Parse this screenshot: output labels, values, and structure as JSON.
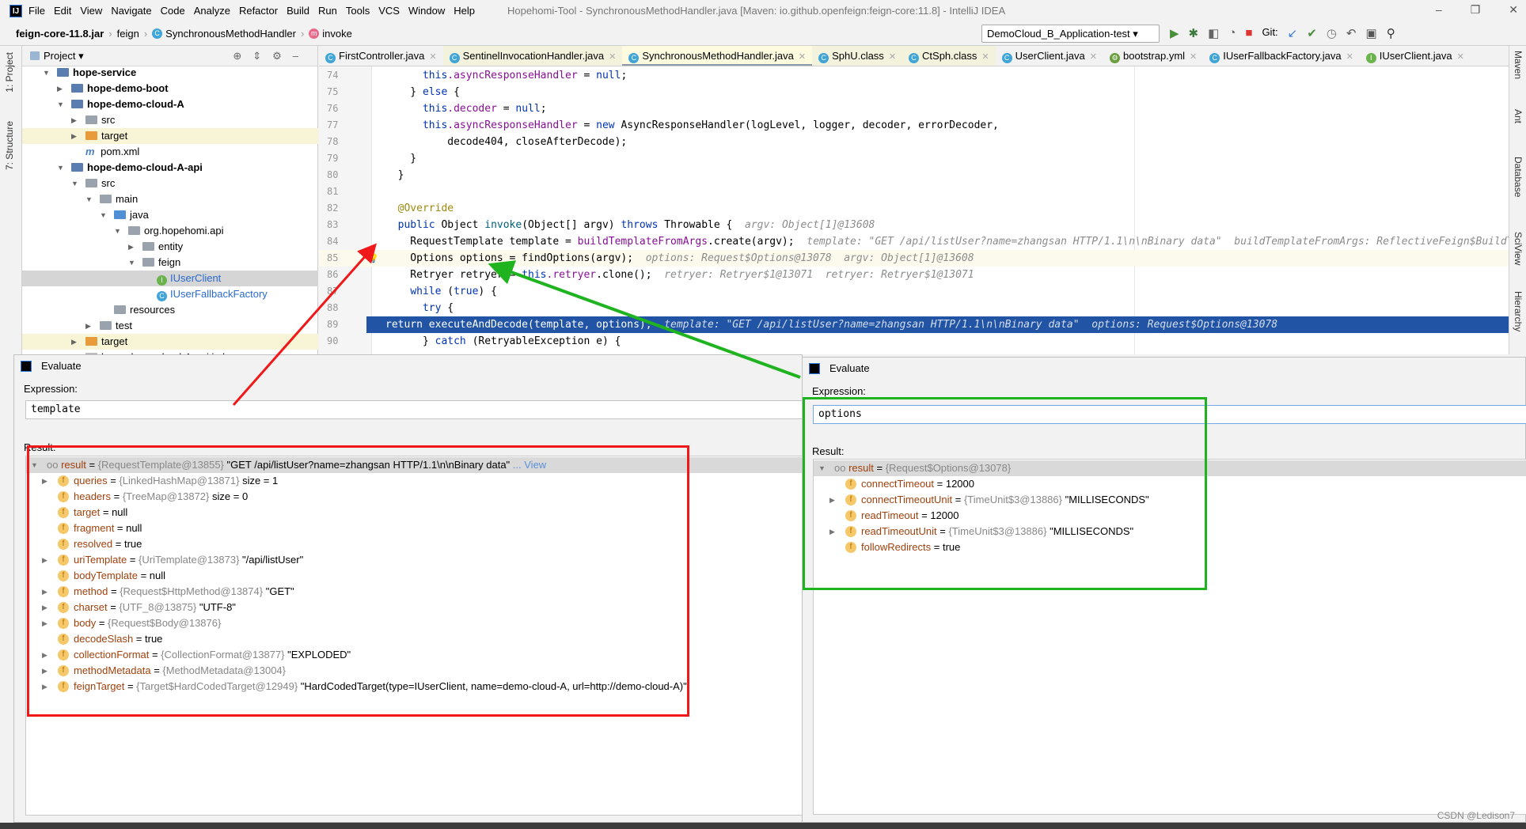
{
  "menubar": {
    "items": [
      "File",
      "Edit",
      "View",
      "Navigate",
      "Code",
      "Analyze",
      "Refactor",
      "Build",
      "Run",
      "Tools",
      "VCS",
      "Window",
      "Help"
    ],
    "title": "Hopehomi-Tool - SynchronousMethodHandler.java [Maven: io.github.openfeign:feign-core:11.8] - IntelliJ IDEA"
  },
  "navbar": {
    "jar": "feign-core-11.8.jar",
    "pkg": "feign",
    "cls": "SynchronousMethodHandler",
    "method": "invoke",
    "run_config": "DemoCloud_B_Application-test",
    "git": "Git:"
  },
  "left_strip": {
    "project": "1: Project",
    "structure": "7: Structure"
  },
  "right_strip": [
    "Maven",
    "Ant",
    "Database",
    "SciView",
    "Hierarchy"
  ],
  "project": {
    "header": "Project",
    "tree": [
      {
        "label": "hope-service",
        "lvl": 1,
        "kind": "module",
        "exp": true,
        "bold": true
      },
      {
        "label": "hope-demo-boot",
        "lvl": 2,
        "kind": "module",
        "exp": false,
        "bold": true
      },
      {
        "label": "hope-demo-cloud-A",
        "lvl": 2,
        "kind": "module",
        "exp": true,
        "bold": true
      },
      {
        "label": "src",
        "lvl": 3,
        "kind": "folder",
        "exp": false
      },
      {
        "label": "target",
        "lvl": 3,
        "kind": "target",
        "exp": false,
        "hl": true
      },
      {
        "label": "pom.xml",
        "lvl": 3,
        "kind": "maven"
      },
      {
        "label": "hope-demo-cloud-A-api",
        "lvl": 2,
        "kind": "module",
        "exp": true,
        "bold": true
      },
      {
        "label": "src",
        "lvl": 3,
        "kind": "folder",
        "exp": true
      },
      {
        "label": "main",
        "lvl": 4,
        "kind": "folder",
        "exp": true
      },
      {
        "label": "java",
        "lvl": 5,
        "kind": "src",
        "exp": true
      },
      {
        "label": "org.hopehomi.api",
        "lvl": 6,
        "kind": "pkg",
        "exp": true
      },
      {
        "label": "entity",
        "lvl": 7,
        "kind": "pkg",
        "exp": false
      },
      {
        "label": "feign",
        "lvl": 7,
        "kind": "pkg",
        "exp": true
      },
      {
        "label": "IUserClient",
        "lvl": 8,
        "kind": "iface",
        "sel": true
      },
      {
        "label": "IUserFallbackFactory",
        "lvl": 8,
        "kind": "class"
      },
      {
        "label": "resources",
        "lvl": 5,
        "kind": "folder"
      },
      {
        "label": "test",
        "lvl": 4,
        "kind": "folder",
        "exp": false
      },
      {
        "label": "target",
        "lvl": 3,
        "kind": "target",
        "exp": false,
        "hl": true
      },
      {
        "label": "hope-demo-cloud-A-api.iml",
        "lvl": 3,
        "kind": "file"
      }
    ]
  },
  "tabs": [
    {
      "label": "FirstController.java",
      "icon": "c"
    },
    {
      "label": "SentinelInvocationHandler.java",
      "icon": "c",
      "y": true
    },
    {
      "label": "SynchronousMethodHandler.java",
      "icon": "c",
      "active": true
    },
    {
      "label": "SphU.class",
      "icon": "c",
      "y": true
    },
    {
      "label": "CtSph.class",
      "icon": "c",
      "y": true
    },
    {
      "label": "UserClient.java",
      "icon": "c"
    },
    {
      "label": "bootstrap.yml",
      "icon": "y"
    },
    {
      "label": "IUserFallbackFactory.java",
      "icon": "c"
    },
    {
      "label": "IUserClient.java",
      "icon": "i"
    }
  ],
  "code": [
    {
      "n": "74",
      "seg": [
        [
          "      ",
          ""
        ],
        [
          "this",
          ".k"
        ],
        [
          ".asyncResponseHandler",
          "f"
        ],
        [
          " = ",
          ""
        ],
        [
          "null",
          "k"
        ],
        [
          ";",
          ""
        ]
      ]
    },
    {
      "n": "75",
      "seg": [
        [
          "    } ",
          ""
        ],
        [
          "else",
          "k"
        ],
        [
          " {",
          ""
        ]
      ]
    },
    {
      "n": "76",
      "seg": [
        [
          "      ",
          ""
        ],
        [
          "this",
          "k"
        ],
        [
          ".decoder",
          "f"
        ],
        [
          " = ",
          ""
        ],
        [
          "null",
          "k"
        ],
        [
          ";",
          ""
        ]
      ]
    },
    {
      "n": "77",
      "seg": [
        [
          "      ",
          ""
        ],
        [
          "this",
          "k"
        ],
        [
          ".asyncResponseHandler",
          "f"
        ],
        [
          " = ",
          ""
        ],
        [
          "new",
          "k"
        ],
        [
          " AsyncResponseHandler(logLevel, logger, decoder, errorDecoder,",
          ""
        ]
      ]
    },
    {
      "n": "78",
      "seg": [
        [
          "          decode404, closeAfterDecode);",
          ""
        ]
      ]
    },
    {
      "n": "79",
      "seg": [
        [
          "    }",
          ""
        ]
      ]
    },
    {
      "n": "80",
      "seg": [
        [
          "  }",
          ""
        ]
      ]
    },
    {
      "n": "81",
      "seg": []
    },
    {
      "n": "82",
      "seg": [
        [
          "  ",
          ""
        ],
        [
          "@Override",
          "a"
        ]
      ]
    },
    {
      "n": "83",
      "seg": [
        [
          "  ",
          ""
        ],
        [
          "public",
          "k"
        ],
        [
          " Object ",
          ""
        ],
        [
          "invoke",
          "m"
        ],
        [
          "(Object[] argv) ",
          ""
        ],
        [
          "throws",
          "k"
        ],
        [
          " Throwable {  ",
          ""
        ],
        [
          "argv: Object[1]@13608",
          "h"
        ]
      ]
    },
    {
      "n": "84",
      "seg": [
        [
          "    RequestTemplate template = ",
          ""
        ],
        [
          "buildTemplateFromArgs",
          "f"
        ],
        [
          ".create(argv);  ",
          ""
        ],
        [
          "template: \"GET /api/listUser?name=zhangsan HTTP/1.1\\n\\nBinary data\"  buildTemplateFromArgs: ReflectiveFeign$BuildTemplateByResolvingArgs",
          "h"
        ]
      ]
    },
    {
      "n": "85",
      "cur": true,
      "seg": [
        [
          "    Options options = findOptions(argv);  ",
          ""
        ],
        [
          "options: Request$Options@13078  argv: Object[1]@13608",
          "h"
        ]
      ]
    },
    {
      "n": "86",
      "seg": [
        [
          "    Retryer retryer = ",
          ""
        ],
        [
          "this",
          "k"
        ],
        [
          ".retryer",
          "f"
        ],
        [
          ".clone();  ",
          ""
        ],
        [
          "retryer: Retryer$1@13071  retryer: Retryer$1@13071",
          "h"
        ]
      ]
    },
    {
      "n": "87",
      "seg": [
        [
          "    ",
          ""
        ],
        [
          "while",
          "k"
        ],
        [
          " (",
          ""
        ],
        [
          "true",
          "k"
        ],
        [
          ") {",
          ""
        ]
      ]
    },
    {
      "n": "88",
      "seg": [
        [
          "      ",
          ""
        ],
        [
          "try",
          "k"
        ],
        [
          " {",
          ""
        ]
      ]
    },
    {
      "n": "89",
      "exec": true,
      "seg": [
        [
          "return executeAndDecode(template, options);  ",
          ""
        ],
        [
          "template: \"GET /api/listUser?name=zhangsan HTTP/1.1\\n\\nBinary data\"  options: Request$Options@13078",
          "h"
        ]
      ]
    },
    {
      "n": "90",
      "seg": [
        [
          "      } ",
          ""
        ],
        [
          "catch",
          "k"
        ],
        [
          " (RetryableException e) {",
          ""
        ]
      ]
    }
  ],
  "eval_left": {
    "title": "Evaluate",
    "expr_label": "Expression:",
    "expr": "template",
    "result_label": "Result:",
    "rows": [
      {
        "name": "result",
        "type": "{RequestTemplate@13855}",
        "val": "\"GET /api/listUser?name=zhangsan HTTP/1.1\\n\\nBinary data\"",
        "link": "... View",
        "top": true,
        "exp": true
      },
      {
        "name": "queries",
        "type": "{LinkedHashMap@13871}",
        "val": " size = 1",
        "exp": true
      },
      {
        "name": "headers",
        "type": "{TreeMap@13872}",
        "val": " size = 0"
      },
      {
        "name": "target",
        "val": "null"
      },
      {
        "name": "fragment",
        "val": "null"
      },
      {
        "name": "resolved",
        "val": "true"
      },
      {
        "name": "uriTemplate",
        "type": "{UriTemplate@13873}",
        "val": "\"/api/listUser\"",
        "exp": true
      },
      {
        "name": "bodyTemplate",
        "val": "null"
      },
      {
        "name": "method",
        "type": "{Request$HttpMethod@13874}",
        "val": "\"GET\"",
        "exp": true
      },
      {
        "name": "charset",
        "type": "{UTF_8@13875}",
        "val": "\"UTF-8\"",
        "exp": true
      },
      {
        "name": "body",
        "type": "{Request$Body@13876}",
        "val": "",
        "exp": true
      },
      {
        "name": "decodeSlash",
        "val": "true"
      },
      {
        "name": "collectionFormat",
        "type": "{CollectionFormat@13877}",
        "val": "\"EXPLODED\"",
        "exp": true
      },
      {
        "name": "methodMetadata",
        "type": "{MethodMetadata@13004}",
        "val": "",
        "exp": true
      },
      {
        "name": "feignTarget",
        "type": "{Target$HardCodedTarget@12949}",
        "val": "\"HardCodedTarget(type=IUserClient, name=demo-cloud-A, url=http://demo-cloud-A)\"",
        "exp": true
      }
    ]
  },
  "eval_right": {
    "title": "Evaluate",
    "expr_label": "Expression:",
    "expr": "options",
    "result_label": "Result:",
    "rows": [
      {
        "name": "result",
        "type": "{Request$Options@13078}",
        "val": "",
        "top": true,
        "exp": true
      },
      {
        "name": "connectTimeout",
        "val": "12000"
      },
      {
        "name": "connectTimeoutUnit",
        "type": "{TimeUnit$3@13886}",
        "val": "\"MILLISECONDS\"",
        "exp": true
      },
      {
        "name": "readTimeout",
        "val": "12000"
      },
      {
        "name": "readTimeoutUnit",
        "type": "{TimeUnit$3@13886}",
        "val": "\"MILLISECONDS\"",
        "exp": true
      },
      {
        "name": "followRedirects",
        "val": "true"
      }
    ]
  },
  "annotations": {
    "red": "#f01818",
    "green": "#1fb41f"
  },
  "watermark": "CSDN @Ledison7"
}
